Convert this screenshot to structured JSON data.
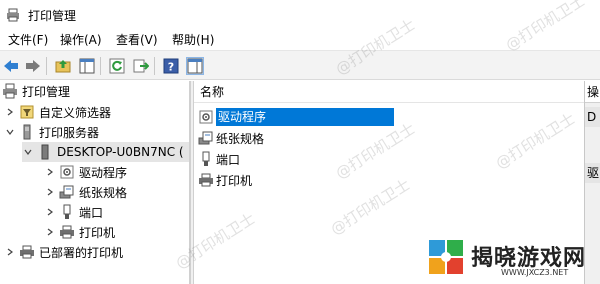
{
  "window": {
    "title": "打印管理"
  },
  "menu": [
    "文件(F)",
    "操作(A)",
    "查看(V)",
    "帮助(H)"
  ],
  "toolbar": [
    "back-icon",
    "forward-icon",
    "up-folder-icon",
    "show-tree-icon",
    "refresh-icon",
    "export-icon",
    "help-icon",
    "view-icon"
  ],
  "tree": {
    "root": "打印管理",
    "custom_filters": "自定义筛选器",
    "print_servers": "打印服务器",
    "server": "DESKTOP-U0BN7NC (",
    "children": [
      "驱动程序",
      "纸张规格",
      "端口",
      "打印机"
    ],
    "deployed": "已部署的打印机"
  },
  "list": {
    "column": "名称",
    "items": [
      "驱动程序",
      "纸张规格",
      "端口",
      "打印机"
    ],
    "selected_index": 0
  },
  "actions_pane": {
    "header": "操",
    "items": [
      "D",
      "驱"
    ]
  },
  "watermark_text": "@打印机卫士",
  "brand": {
    "name": "揭晓游戏网",
    "url": "WWW.JXCZ3.NET"
  },
  "colors": {
    "selection": "#0078d7",
    "accent_green": "#2e9a3e"
  }
}
